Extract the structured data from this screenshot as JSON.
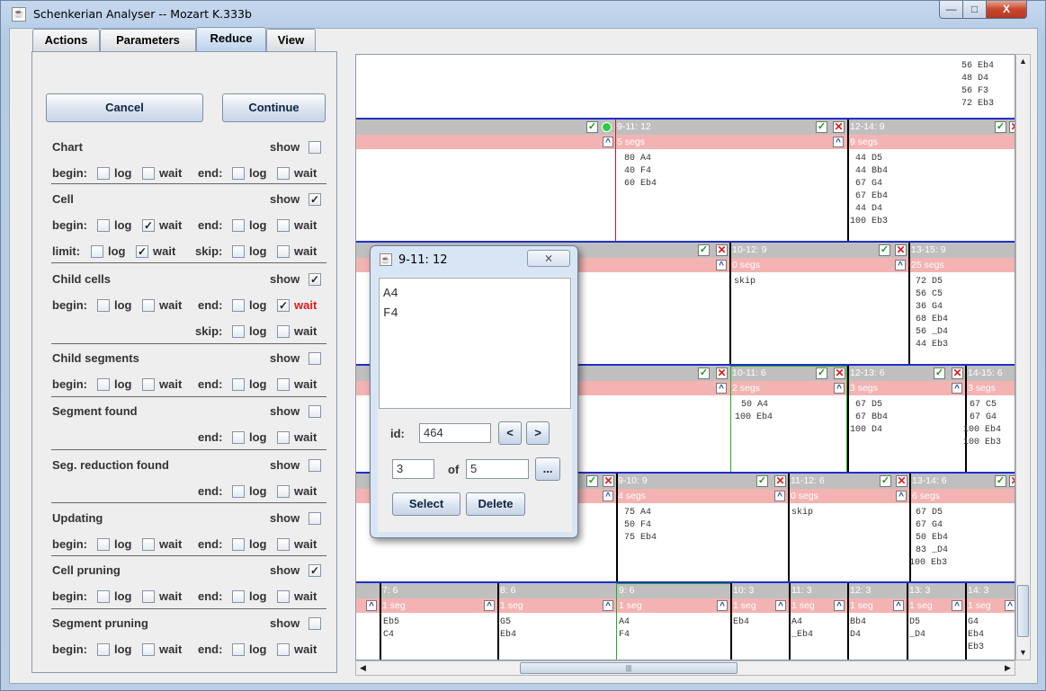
{
  "window": {
    "title": "Schenkerian Analyser -- Mozart K.333b",
    "min_label": "—",
    "max_label": "□",
    "close_label": "X"
  },
  "tabs": [
    {
      "label": "Actions"
    },
    {
      "label": "Parameters"
    },
    {
      "label": "Reduce"
    },
    {
      "label": "View"
    }
  ],
  "controls": {
    "cancel_label": "Cancel",
    "continue_label": "Continue"
  },
  "labels": {
    "show": "show",
    "begin": "begin:",
    "end": "end:",
    "limit": "limit:",
    "skip": "skip:",
    "log": "log",
    "wait": "wait"
  },
  "sections": [
    {
      "name": "Chart",
      "show": false
    },
    {
      "name": "Cell",
      "show": true
    },
    {
      "name": "Child cells",
      "show": true
    },
    {
      "name": "Child segments",
      "show": false
    },
    {
      "name": "Segment found",
      "show": false
    },
    {
      "name": "Seg. reduction found",
      "show": false
    },
    {
      "name": "Updating",
      "show": false
    },
    {
      "name": "Cell pruning",
      "show": true
    },
    {
      "name": "Segment pruning",
      "show": false
    }
  ],
  "check_glyph": "✓",
  "colors": {
    "wait_highlight": "#e01b1b",
    "cell_header": "#bfbfbf",
    "segment_bar": "#f4b3b3",
    "level_line": "#2030c8"
  },
  "grid": {
    "top_notes": [
      "56 Eb4",
      "48 D4",
      "56 F3",
      "72 Eb3"
    ],
    "row1": [
      {
        "id": "9-11: 12",
        "segs": "5 segs",
        "notes": [
          "80 A4",
          "40 F4",
          "60 Eb4"
        ]
      },
      {
        "id": "12-14: 9",
        "segs": "9 segs",
        "notes": [
          "44 D5",
          "44 Bb4",
          "67 G4",
          "67 Eb4",
          "44 D4",
          "100 Eb3"
        ]
      }
    ],
    "row2": [
      {
        "id": "10-12: 9",
        "segs": "0 segs",
        "notes": [
          "skip"
        ]
      },
      {
        "id": "13-15: 9",
        "segs": "25 segs",
        "notes": [
          "72 D5",
          "56 C5",
          "36 G4",
          "68 Eb4",
          "56 _D4",
          "44 Eb3"
        ]
      }
    ],
    "row3": [
      {
        "id": "10-11: 6",
        "segs": "2 segs",
        "notes": [
          "50 A4",
          "100 Eb4"
        ]
      },
      {
        "id": "12-13: 6",
        "segs": "3 segs",
        "notes": [
          "67 D5",
          "67 Bb4",
          "100 D4"
        ]
      },
      {
        "id": "14-15: 6",
        "segs": "3 segs",
        "notes": [
          "67 C5",
          "67 G4",
          "100 Eb4",
          "100 Eb3"
        ]
      }
    ],
    "row4": [
      {
        "id": "9-10: 9",
        "segs": "4 segs",
        "notes": [
          "75 A4",
          "50 F4",
          "75 Eb4"
        ]
      },
      {
        "id": "11-12: 6",
        "segs": "0 segs",
        "notes": [
          "skip"
        ]
      },
      {
        "id": "13-14: 6",
        "segs": "6 segs",
        "notes": [
          "67 D5",
          "67 G4",
          "50 Eb4",
          "83 _D4",
          "100 Eb3"
        ]
      }
    ],
    "row5": [
      {
        "id": "7: 6",
        "segs": "1 seg",
        "notes": [
          "Eb5",
          "C4"
        ]
      },
      {
        "id": "8: 6",
        "segs": "1 seg",
        "notes": [
          "G5",
          "Eb4"
        ]
      },
      {
        "id": "9: 6",
        "segs": "1 seg",
        "notes": [
          "A4",
          "F4"
        ]
      },
      {
        "id": "10: 3",
        "segs": "1 seg",
        "notes": [
          "Eb4"
        ]
      },
      {
        "id": "11: 3",
        "segs": "1 seg",
        "notes": [
          "A4",
          "_Eb4"
        ]
      },
      {
        "id": "12: 3",
        "segs": "1 seg",
        "notes": [
          "Bb4",
          "D4"
        ]
      },
      {
        "id": "13: 3",
        "segs": "1 seg",
        "notes": [
          "D5",
          "_D4"
        ]
      },
      {
        "id": "14: 3",
        "segs": "1 seg",
        "notes": [
          "G4",
          "Eb4",
          "Eb3"
        ]
      }
    ]
  },
  "dialog": {
    "title": "9-11: 12",
    "close_glyph": "⨯",
    "text_lines": [
      "A4",
      "F4"
    ],
    "id_label": "id:",
    "id_value": "464",
    "prev_label": "<",
    "next_label": ">",
    "index_value": "3",
    "of_label": "of",
    "total_value": "5",
    "more_label": "...",
    "select_label": "Select",
    "delete_label": "Delete"
  },
  "scroll": {
    "h_grip": "|||"
  }
}
